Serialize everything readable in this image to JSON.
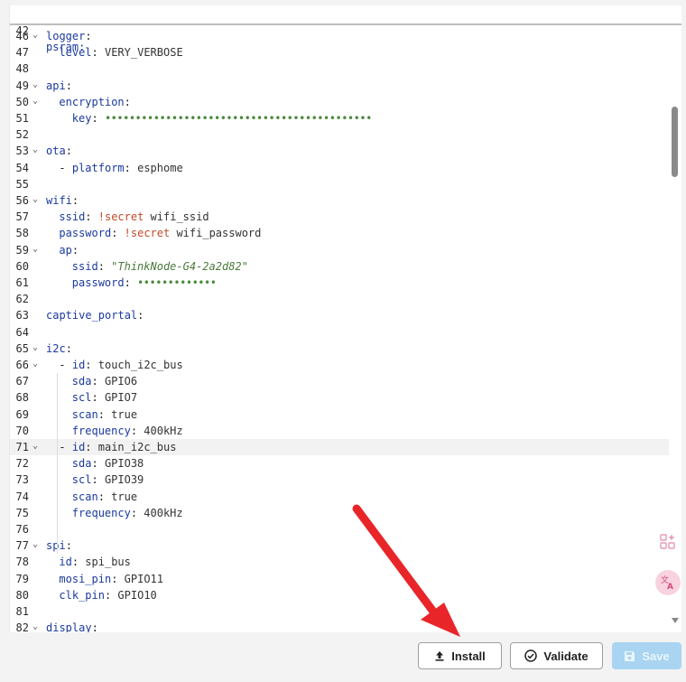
{
  "sticky": {
    "num": "42",
    "text": "psram:"
  },
  "lines": [
    {
      "n": "46",
      "fold": true,
      "tokens": [
        [
          "k",
          "logger"
        ],
        [
          "p",
          ":"
        ]
      ]
    },
    {
      "n": "47",
      "indent": 1,
      "tokens": [
        [
          "k",
          "level"
        ],
        [
          "p",
          ": "
        ],
        [
          "sv",
          "VERY_VERBOSE"
        ]
      ]
    },
    {
      "n": "48",
      "tokens": []
    },
    {
      "n": "49",
      "fold": true,
      "tokens": [
        [
          "k",
          "api"
        ],
        [
          "p",
          ":"
        ]
      ]
    },
    {
      "n": "50",
      "fold": true,
      "indent": 1,
      "tokens": [
        [
          "k",
          "encryption"
        ],
        [
          "p",
          ":"
        ]
      ]
    },
    {
      "n": "51",
      "indent": 2,
      "tokens": [
        [
          "k",
          "key"
        ],
        [
          "p",
          ": "
        ],
        [
          "dots",
          "••••••••••••••••••••••••••••••••••••••••••••"
        ]
      ]
    },
    {
      "n": "52",
      "tokens": []
    },
    {
      "n": "53",
      "fold": true,
      "tokens": [
        [
          "k",
          "ota"
        ],
        [
          "p",
          ":"
        ]
      ]
    },
    {
      "n": "54",
      "indent": 1,
      "tokens": [
        [
          "p",
          "- "
        ],
        [
          "k",
          "platform"
        ],
        [
          "p",
          ": "
        ],
        [
          "sv",
          "esphome"
        ]
      ]
    },
    {
      "n": "55",
      "tokens": []
    },
    {
      "n": "56",
      "fold": true,
      "tokens": [
        [
          "k",
          "wifi"
        ],
        [
          "p",
          ":"
        ]
      ]
    },
    {
      "n": "57",
      "indent": 1,
      "tokens": [
        [
          "k",
          "ssid"
        ],
        [
          "p",
          ": "
        ],
        [
          "sec",
          "!secret"
        ],
        [
          "sv",
          " wifi_ssid"
        ]
      ]
    },
    {
      "n": "58",
      "indent": 1,
      "tokens": [
        [
          "k",
          "password"
        ],
        [
          "p",
          ": "
        ],
        [
          "sec",
          "!secret"
        ],
        [
          "sv",
          " wifi_password"
        ]
      ]
    },
    {
      "n": "59",
      "fold": true,
      "indent": 1,
      "tokens": [
        [
          "k",
          "ap"
        ],
        [
          "p",
          ":"
        ]
      ]
    },
    {
      "n": "60",
      "indent": 2,
      "tokens": [
        [
          "k",
          "ssid"
        ],
        [
          "p",
          ": "
        ],
        [
          "str",
          "\"ThinkNode-G4-2a2d82\""
        ]
      ]
    },
    {
      "n": "61",
      "indent": 2,
      "tokens": [
        [
          "k",
          "password"
        ],
        [
          "p",
          ": "
        ],
        [
          "dots",
          "•••••••••••••"
        ]
      ]
    },
    {
      "n": "62",
      "tokens": []
    },
    {
      "n": "63",
      "tokens": [
        [
          "k",
          "captive_portal"
        ],
        [
          "p",
          ":"
        ]
      ]
    },
    {
      "n": "64",
      "tokens": []
    },
    {
      "n": "65",
      "fold": true,
      "tokens": [
        [
          "k",
          "i2c"
        ],
        [
          "p",
          ":"
        ]
      ]
    },
    {
      "n": "66",
      "fold": true,
      "indent": 1,
      "tokens": [
        [
          "p",
          "- "
        ],
        [
          "k",
          "id"
        ],
        [
          "p",
          ": "
        ],
        [
          "sv",
          "touch_i2c_bus"
        ]
      ]
    },
    {
      "n": "67",
      "indent": 2,
      "tokens": [
        [
          "k",
          "sda"
        ],
        [
          "p",
          ": "
        ],
        [
          "sv",
          "GPIO6"
        ]
      ]
    },
    {
      "n": "68",
      "indent": 2,
      "tokens": [
        [
          "k",
          "scl"
        ],
        [
          "p",
          ": "
        ],
        [
          "sv",
          "GPIO7"
        ]
      ]
    },
    {
      "n": "69",
      "indent": 2,
      "tokens": [
        [
          "k",
          "scan"
        ],
        [
          "p",
          ": "
        ],
        [
          "sv",
          "true"
        ]
      ]
    },
    {
      "n": "70",
      "indent": 2,
      "tokens": [
        [
          "k",
          "frequency"
        ],
        [
          "p",
          ": "
        ],
        [
          "sv",
          "400kHz"
        ]
      ]
    },
    {
      "n": "71",
      "fold": true,
      "indent": 1,
      "active": true,
      "tokens": [
        [
          "p",
          "- "
        ],
        [
          "k",
          "id"
        ],
        [
          "p",
          ": "
        ],
        [
          "sv",
          "main_i2c_bus"
        ]
      ]
    },
    {
      "n": "72",
      "indent": 2,
      "tokens": [
        [
          "k",
          "sda"
        ],
        [
          "p",
          ": "
        ],
        [
          "sv",
          "GPIO38"
        ]
      ]
    },
    {
      "n": "73",
      "indent": 2,
      "tokens": [
        [
          "k",
          "scl"
        ],
        [
          "p",
          ": "
        ],
        [
          "sv",
          "GPIO39"
        ]
      ]
    },
    {
      "n": "74",
      "indent": 2,
      "tokens": [
        [
          "k",
          "scan"
        ],
        [
          "p",
          ": "
        ],
        [
          "sv",
          "true"
        ]
      ]
    },
    {
      "n": "75",
      "indent": 2,
      "tokens": [
        [
          "k",
          "frequency"
        ],
        [
          "p",
          ": "
        ],
        [
          "sv",
          "400kHz"
        ]
      ]
    },
    {
      "n": "76",
      "tokens": []
    },
    {
      "n": "77",
      "fold": true,
      "tokens": [
        [
          "k",
          "spi"
        ],
        [
          "p",
          ":"
        ]
      ]
    },
    {
      "n": "78",
      "indent": 1,
      "tokens": [
        [
          "k",
          "id"
        ],
        [
          "p",
          ": "
        ],
        [
          "sv",
          "spi_bus"
        ]
      ]
    },
    {
      "n": "79",
      "indent": 1,
      "tokens": [
        [
          "k",
          "mosi_pin"
        ],
        [
          "p",
          ": "
        ],
        [
          "sv",
          "GPIO11"
        ]
      ]
    },
    {
      "n": "80",
      "indent": 1,
      "tokens": [
        [
          "k",
          "clk_pin"
        ],
        [
          "p",
          ": "
        ],
        [
          "sv",
          "GPIO10"
        ]
      ]
    },
    {
      "n": "81",
      "tokens": []
    },
    {
      "n": "82",
      "fold": true,
      "tokens": [
        [
          "k",
          "display"
        ],
        [
          "p",
          ":"
        ]
      ]
    }
  ],
  "buttons": {
    "install": "Install",
    "validate": "Validate",
    "save": "Save"
  },
  "colors": {
    "key": "#1b3a9e",
    "string": "#4a7a3a",
    "secret": "#c24a2a",
    "save_bg": "#a9d4f2",
    "annotation_arrow": "#e8262a"
  }
}
